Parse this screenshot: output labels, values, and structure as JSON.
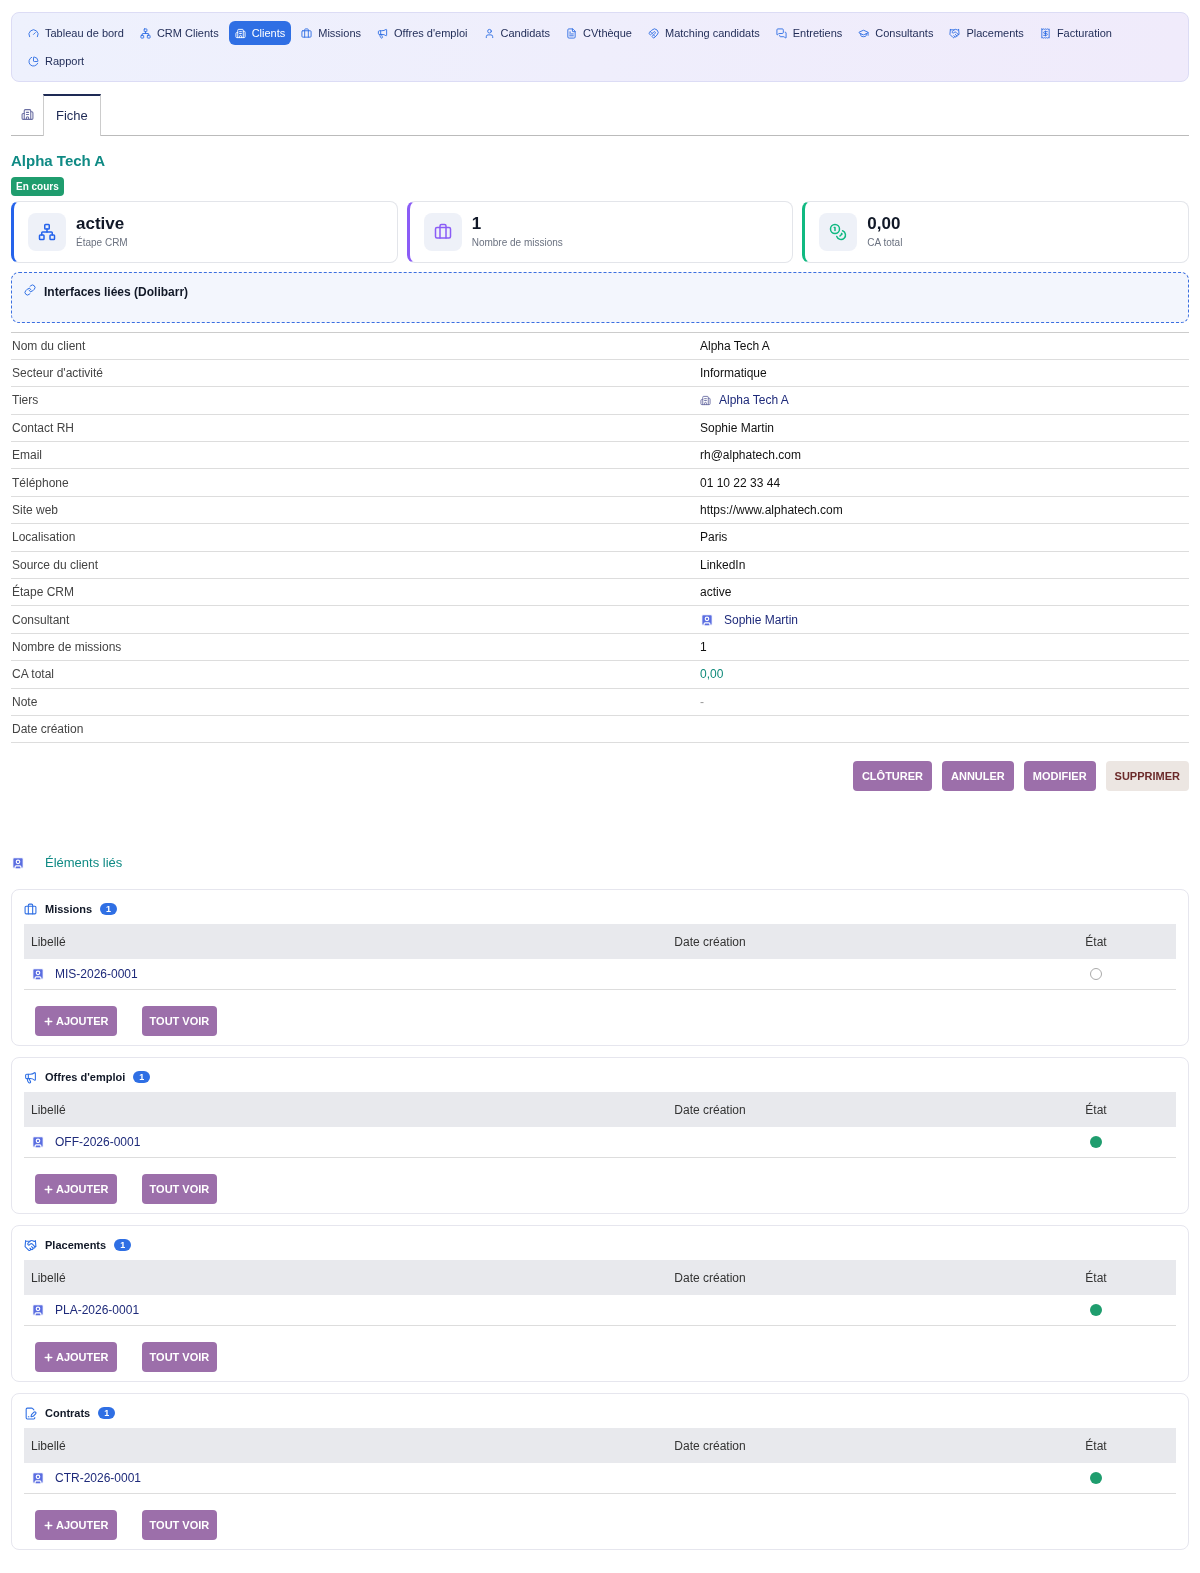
{
  "nav": [
    {
      "label": "Tableau de bord",
      "selected": false
    },
    {
      "label": "CRM Clients",
      "selected": false
    },
    {
      "label": "Clients",
      "selected": true
    },
    {
      "label": "Missions",
      "selected": false
    },
    {
      "label": "Offres d'emploi",
      "selected": false
    },
    {
      "label": "Candidats",
      "selected": false
    },
    {
      "label": "CVthèque",
      "selected": false
    },
    {
      "label": "Matching candidats",
      "selected": false
    },
    {
      "label": "Entretiens",
      "selected": false
    },
    {
      "label": "Consultants",
      "selected": false
    },
    {
      "label": "Placements",
      "selected": false
    },
    {
      "label": "Facturation",
      "selected": false
    },
    {
      "label": "Rapport",
      "selected": false
    }
  ],
  "tabs": [
    {
      "label": "Fiche",
      "selected": true
    }
  ],
  "title": "Alpha Tech A",
  "status_badge": "En cours",
  "stats": [
    {
      "value": "active",
      "label": "Étape CRM"
    },
    {
      "value": "1",
      "label": "Nombre de missions"
    },
    {
      "value": "0,00",
      "label": "CA total"
    }
  ],
  "linked_interfaces": {
    "title": "Interfaces liées (Dolibarr)"
  },
  "fields": [
    {
      "label": "Nom du client",
      "value": "Alpha Tech A",
      "kind": "text"
    },
    {
      "label": "Secteur d'activité",
      "value": "Informatique",
      "kind": "text"
    },
    {
      "label": "Tiers",
      "value": "Alpha Tech A",
      "kind": "company"
    },
    {
      "label": "Contact RH",
      "value": "Sophie Martin",
      "kind": "text"
    },
    {
      "label": "Email",
      "value": "rh@alphatech.com",
      "kind": "text"
    },
    {
      "label": "Téléphone",
      "value": "01 10 22 33 44",
      "kind": "text"
    },
    {
      "label": "Site web",
      "value": "https://www.alphatech.com",
      "kind": "text"
    },
    {
      "label": "Localisation",
      "value": "Paris",
      "kind": "text"
    },
    {
      "label": "Source du client",
      "value": "LinkedIn",
      "kind": "text"
    },
    {
      "label": "Étape CRM",
      "value": "active",
      "kind": "text"
    },
    {
      "label": "Consultant",
      "value": "Sophie Martin",
      "kind": "user"
    },
    {
      "label": "Nombre de missions",
      "value": "1",
      "kind": "text"
    },
    {
      "label": "CA total",
      "value": "0,00",
      "kind": "amount"
    },
    {
      "label": "Note",
      "value": "-",
      "kind": "muted"
    },
    {
      "label": "Date création"
    }
  ],
  "actions": [
    {
      "label": "CLÔTURER",
      "kind": "primary"
    },
    {
      "label": "ANNULER",
      "kind": "primary"
    },
    {
      "label": "MODIFIER",
      "kind": "primary"
    },
    {
      "label": "SUPPRIMER",
      "kind": "danger"
    }
  ],
  "linked_title": "Éléments liés",
  "sections": [
    {
      "title": "Missions",
      "count": "1",
      "columns": [
        "Libellé",
        "Date création",
        "État"
      ],
      "rows": [
        {
          "ref": "MIS-2026-0001",
          "active": false
        }
      ],
      "buttons": [
        "AJOUTER",
        "TOUT VOIR"
      ]
    },
    {
      "title": "Offres d'emploi",
      "count": "1",
      "columns": [
        "Libellé",
        "Date création",
        "État"
      ],
      "rows": [
        {
          "ref": "OFF-2026-0001",
          "active": true
        }
      ],
      "buttons": [
        "AJOUTER",
        "TOUT VOIR"
      ]
    },
    {
      "title": "Placements",
      "count": "1",
      "columns": [
        "Libellé",
        "Date création",
        "État"
      ],
      "rows": [
        {
          "ref": "PLA-2026-0001",
          "active": true
        }
      ],
      "buttons": [
        "AJOUTER",
        "TOUT VOIR"
      ]
    },
    {
      "title": "Contrats",
      "count": "1",
      "columns": [
        "Libellé",
        "Date création",
        "État"
      ],
      "rows": [
        {
          "ref": "CTR-2026-0001",
          "active": true
        }
      ],
      "buttons": [
        "AJOUTER",
        "TOUT VOIR"
      ]
    }
  ]
}
